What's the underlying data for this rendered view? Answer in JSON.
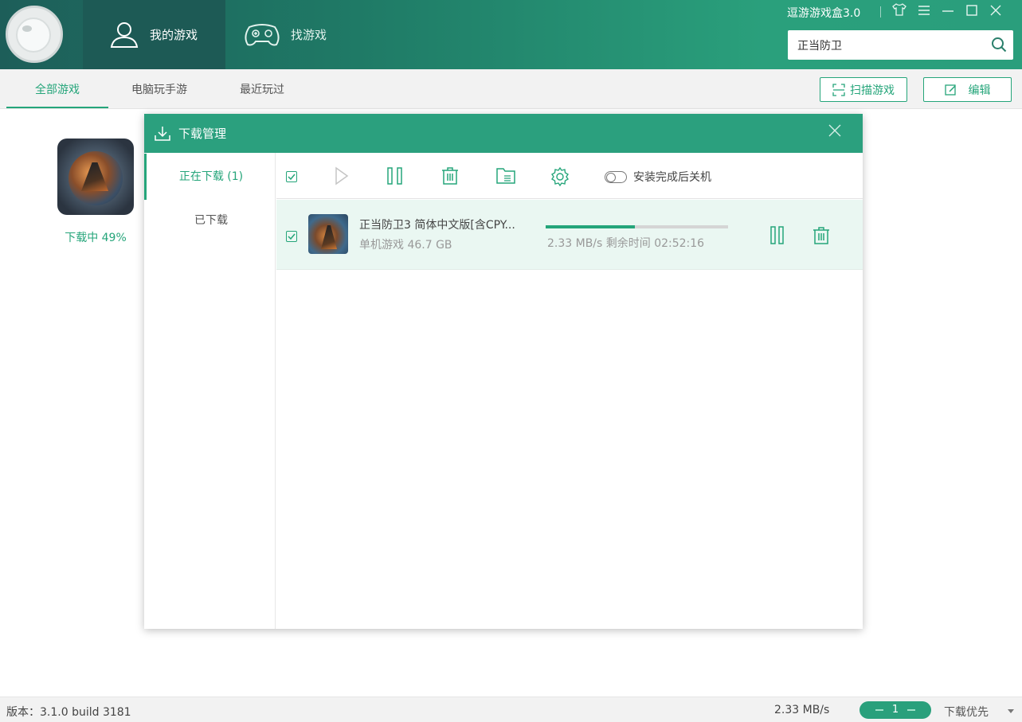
{
  "header": {
    "tabs": [
      {
        "label": "我的游戏",
        "active": true
      },
      {
        "label": "找游戏",
        "active": false
      }
    ],
    "app_title": "逗游游戏盒3.0",
    "search": {
      "value": "正当防卫"
    }
  },
  "subnav": {
    "tabs": [
      {
        "label": "全部游戏",
        "active": true
      },
      {
        "label": "电脑玩手游",
        "active": false
      },
      {
        "label": "最近玩过",
        "active": false
      }
    ],
    "scan_label": "扫描游戏",
    "edit_label": "编辑"
  },
  "game_tile": {
    "status": "下载中 49%"
  },
  "dialog": {
    "title": "下载管理",
    "side": [
      {
        "label": "正在下载 (1)",
        "active": true
      },
      {
        "label": "已下载",
        "active": false
      }
    ],
    "toolbar": {
      "shutdown_label": "安装完成后关机",
      "shutdown_on": false
    },
    "downloads": [
      {
        "title": "正当防卫3  简体中文版[含CPY...",
        "meta": "单机游戏  46.7 GB",
        "progress": 0.49,
        "speed": "2.33 MB/s 剩余时间 02:52:16",
        "checked": true
      }
    ]
  },
  "statusbar": {
    "version": "版本：3.1.0 build 3181",
    "speed": "2.33 MB/s",
    "count": "1",
    "priority": "下载优先"
  },
  "colors": {
    "accent": "#25a57a",
    "header_start": "#1d5e59",
    "header_end": "#2a9e7c"
  }
}
